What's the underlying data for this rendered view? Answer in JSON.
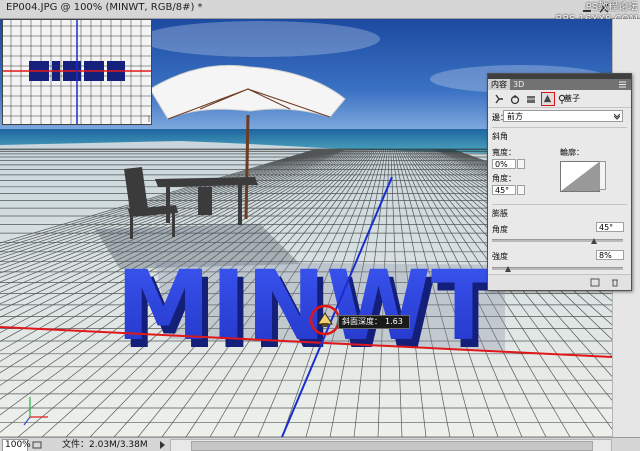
{
  "window": {
    "title": "EP004.JPG @ 100% (MINWT, RGB/8#) *",
    "watermark_line1": "PS教程论坛",
    "watermark_line2": "BBS.16XX8.COM"
  },
  "scene_text": "MINWT",
  "tooltip": {
    "label": "斜面深度：",
    "value": "1.63"
  },
  "status_bar": {
    "zoom": "100%",
    "doc_info": "文件：2.03M/3.38M"
  },
  "panel": {
    "tabs": [
      "内容",
      "3D"
    ],
    "toolbar_label": "蓋子",
    "edge": {
      "label": "邊：",
      "value": "前方"
    },
    "bevel": {
      "title": "斜角",
      "width_label": "寬度：",
      "width_value": "0%",
      "angle_label": "角度：",
      "angle_value": "45°",
      "contour_label": "輪廓："
    },
    "inflate": {
      "title": "膨脹",
      "angle_label": "角度",
      "angle_value": "45°",
      "strength_label": "強度",
      "strength_value": "8%",
      "angle_level": 0.78,
      "strength_level": 0.12
    }
  },
  "colors": {
    "guide_red": "#e0181a",
    "guide_blue": "#1a2dcf",
    "text_3d": "#2f45e6",
    "highlight": "#e01414"
  },
  "icons": [
    "chevron-down-icon",
    "camera-icon",
    "lock-icon",
    "mesh-icon",
    "bevel-icon",
    "light-icon",
    "swap-icon",
    "trash-icon",
    "panel-menu-icon",
    "axis-widget-icon",
    "drag-cursor-icon"
  ]
}
